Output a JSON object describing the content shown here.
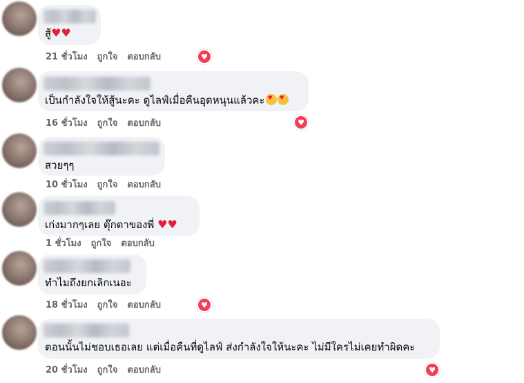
{
  "labels": {
    "like": "ถูกใจ",
    "reply": "ตอบกลับ"
  },
  "reaction": {
    "icon": "love-reaction-icon",
    "color": "#f33e58"
  },
  "comments": [
    {
      "text": "สู้",
      "emoji_suffix": "♥♥",
      "time": "21 ชั่วโมง",
      "has_reaction": true
    },
    {
      "text": "เป็นกำลังใจให้สู้นะคะ ดูไลฟ์เมื่อคืนอุดหนุนแล้วคะ",
      "emoji_suffix": "",
      "time": "16 ชั่วโมง",
      "has_reaction": true
    },
    {
      "text": "สวยๆๆ",
      "emoji_suffix": "",
      "time": "10 ชั่วโมง",
      "has_reaction": false
    },
    {
      "text": "เก่งมากๆเลย ตุ๊กตาของพี่ ",
      "emoji_suffix": "♥♥",
      "time": "1 ชั่วโมง",
      "has_reaction": false
    },
    {
      "text": "ทำไมถึงยกเลิกเนอะ",
      "emoji_suffix": "",
      "time": "18 ชั่วโมง",
      "has_reaction": true
    },
    {
      "text": "ตอนนั้นไม่ชอบเธอเลย แต่เมื่อคืนที่ดูไลฟ์ ส่งกำลังใจให้นะคะ ไม่มีใครไม่เคยทำผิดคะ",
      "emoji_suffix": "",
      "time": "20 ชั่วโมง",
      "has_reaction": true
    }
  ]
}
